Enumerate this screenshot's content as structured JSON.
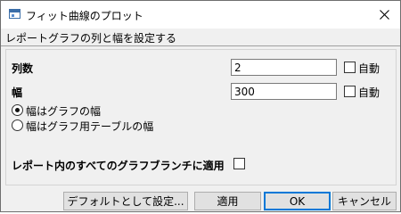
{
  "window": {
    "title": "フィット曲線のプロット",
    "icon": "app-window-icon",
    "close_icon": "close-icon"
  },
  "header": {
    "text": "レポートグラフの列と幅を設定する"
  },
  "form": {
    "columns_label": "列数",
    "columns_value": "2",
    "columns_auto_label": "自動",
    "columns_auto_checked": false,
    "width_label": "幅",
    "width_value": "300",
    "width_auto_label": "自動",
    "width_auto_checked": false,
    "radio_options": [
      {
        "label": "幅はグラフの幅",
        "selected": true
      },
      {
        "label": "幅はグラフ用テーブルの幅",
        "selected": false
      }
    ],
    "apply_all_label": "レポート内のすべてのグラフブランチに適用",
    "apply_all_checked": false
  },
  "buttons": {
    "set_default": "デフォルトとして設定...",
    "apply": "適用",
    "ok": "OK",
    "cancel": "キャンセル"
  },
  "colors": {
    "accent": "#0078d7",
    "dialog_bg": "#f0f0f0",
    "button_bg": "#e1e1e1"
  }
}
